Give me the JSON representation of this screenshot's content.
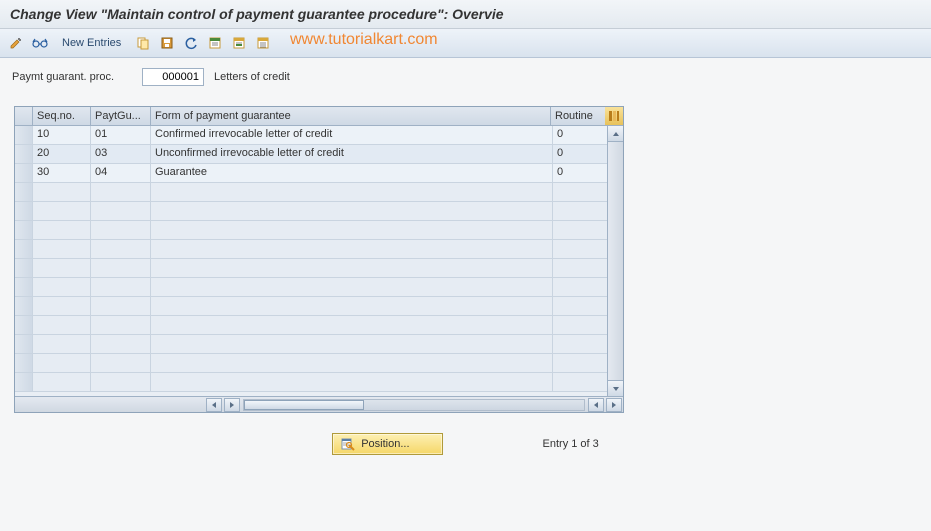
{
  "title": "Change View \"Maintain control of payment guarantee procedure\": Overvie",
  "toolbar": {
    "new_entries_label": "New Entries"
  },
  "watermark": "www.tutorialkart.com",
  "header": {
    "label": "Paymt guarant. proc.",
    "value": "000001",
    "description": "Letters of credit"
  },
  "grid": {
    "columns": {
      "seq": "Seq.no.",
      "payt": "PaytGu...",
      "form": "Form of payment guarantee",
      "routine": "Routine"
    },
    "rows": [
      {
        "seq": "10",
        "payt": "01",
        "form": "Confirmed irrevocable letter of credit",
        "routine": "0"
      },
      {
        "seq": "20",
        "payt": "03",
        "form": "Unconfirmed irrevocable letter of credit",
        "routine": "0"
      },
      {
        "seq": "30",
        "payt": "04",
        "form": "Guarantee",
        "routine": "0"
      }
    ],
    "empty_rows": 11
  },
  "footer": {
    "position_label": "Position...",
    "entry_text": "Entry 1 of 3"
  }
}
